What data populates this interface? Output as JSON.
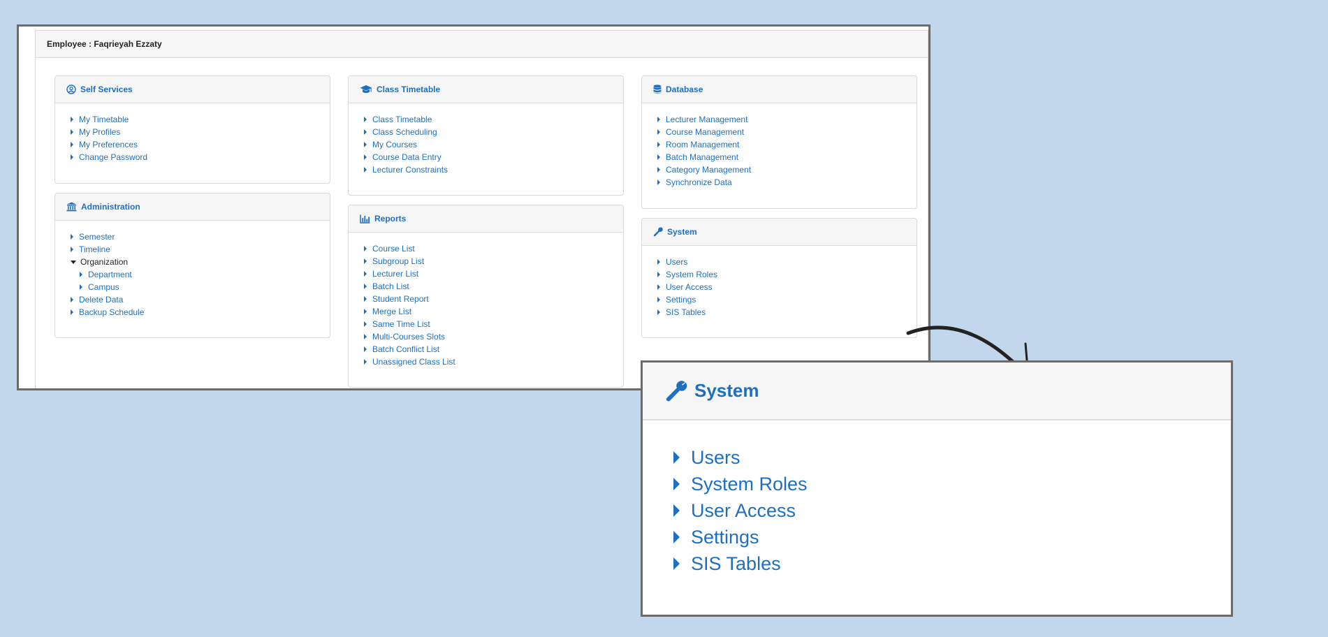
{
  "header": {
    "employee_label": "Employee : Faqrieyah Ezzaty"
  },
  "panels": {
    "self_services": {
      "title": "Self Services",
      "icon": "user-circle-icon",
      "items": [
        "My Timetable",
        "My Profiles",
        "My Preferences",
        "Change Password"
      ]
    },
    "administration": {
      "title": "Administration",
      "icon": "institution-icon",
      "items": [
        "Semester",
        "Timeline",
        "Organization",
        "Department",
        "Campus",
        "Delete Data",
        "Backup Schedule"
      ]
    },
    "class_timetable": {
      "title": "Class Timetable",
      "icon": "graduation-cap-icon",
      "items": [
        "Class Timetable",
        "Class Scheduling",
        "My Courses",
        "Course Data Entry",
        "Lecturer Constraints"
      ]
    },
    "reports": {
      "title": "Reports",
      "icon": "bar-chart-icon",
      "items": [
        "Course List",
        "Subgroup List",
        "Lecturer List",
        "Batch List",
        "Student Report",
        "Merge List",
        "Same Time List",
        "Multi-Courses Slots",
        "Batch Conflict List",
        "Unassigned Class List"
      ]
    },
    "database": {
      "title": "Database",
      "icon": "database-icon",
      "items": [
        "Lecturer Management",
        "Course Management",
        "Room Management",
        "Batch Management",
        "Category Management",
        "Synchronize Data"
      ]
    },
    "system": {
      "title": "System",
      "icon": "wrench-icon",
      "items": [
        "Users",
        "System Roles",
        "User Access",
        "Settings",
        "SIS Tables"
      ]
    }
  },
  "colors": {
    "link": "#1e6fc0",
    "background": "#c2d7eb",
    "panel_header": "#f6f6f6"
  }
}
